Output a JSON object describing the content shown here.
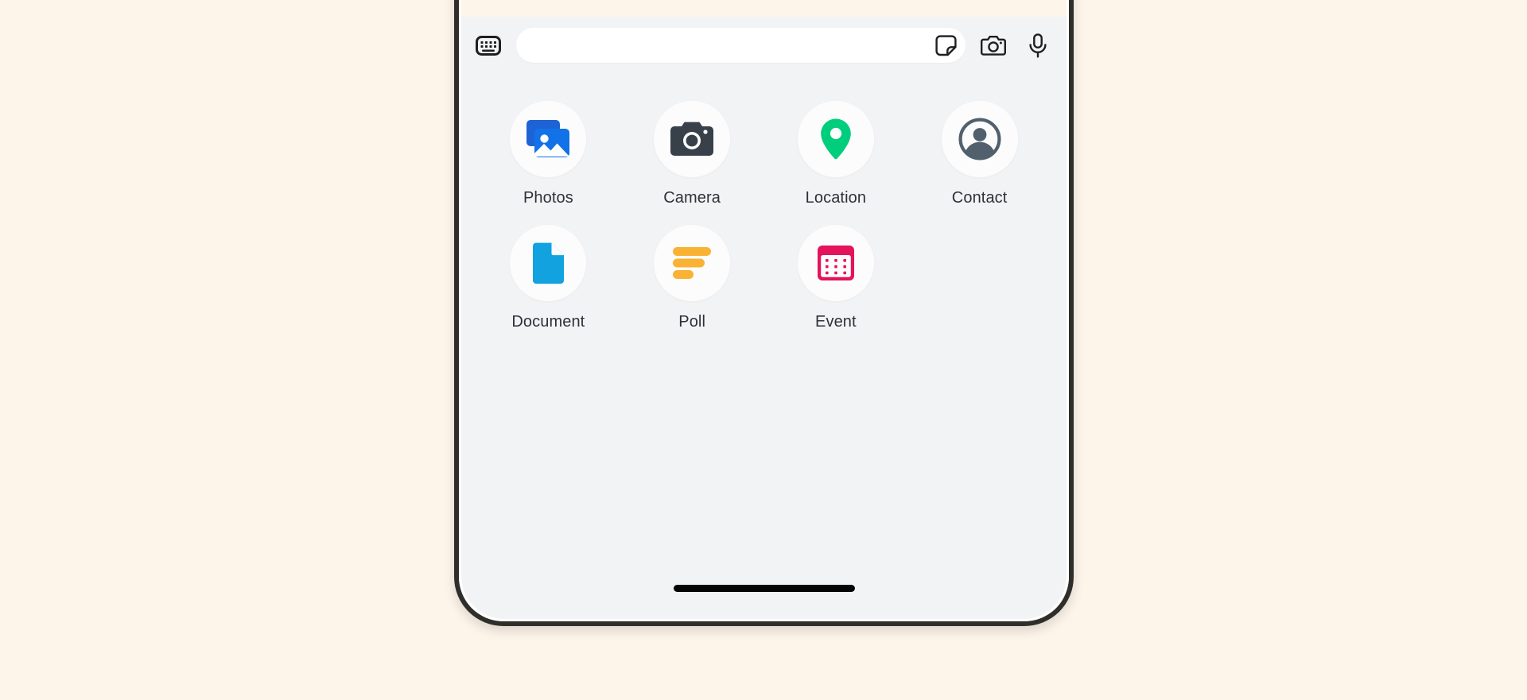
{
  "page": {
    "background_color": "#FDF4EA"
  },
  "phone": {
    "screen_background": "#F2F3F5",
    "frame_color": "#2f2e2b",
    "chat_area": {
      "name": "chat-message-area",
      "background_color": "#FDF4EA",
      "doodle_color": "#EADFCD"
    },
    "home_indicator": {
      "name": "home-indicator",
      "color": "#050505"
    }
  },
  "composer": {
    "keyboard_button": {
      "icon": "keyboard-icon",
      "color": "#1f1f1f"
    },
    "input": {
      "value": "",
      "placeholder": "",
      "background_color": "#FFFFFF"
    },
    "sticker_button": {
      "icon": "sticker-icon",
      "color": "#1f1f1f"
    },
    "camera_button": {
      "icon": "camera-outline-icon",
      "color": "#1f1f1f"
    },
    "mic_button": {
      "icon": "microphone-icon",
      "color": "#1f1f1f"
    }
  },
  "attachment_panel": {
    "circle_background": "#FCFCFC",
    "rows": [
      [
        {
          "label": "Photos",
          "icon": "photos-icon",
          "color": "#1272E8"
        },
        {
          "label": "Camera",
          "icon": "camera-icon",
          "color": "#384049"
        },
        {
          "label": "Location",
          "icon": "location-pin-icon",
          "color": "#00CE7C"
        },
        {
          "label": "Contact",
          "icon": "contact-person-icon",
          "color": "#52606D"
        }
      ],
      [
        {
          "label": "Document",
          "icon": "document-icon",
          "color": "#12A2E0"
        },
        {
          "label": "Poll",
          "icon": "poll-icon",
          "color": "#F9B233"
        },
        {
          "label": "Event",
          "icon": "calendar-icon",
          "color": "#E4135B"
        }
      ]
    ]
  }
}
